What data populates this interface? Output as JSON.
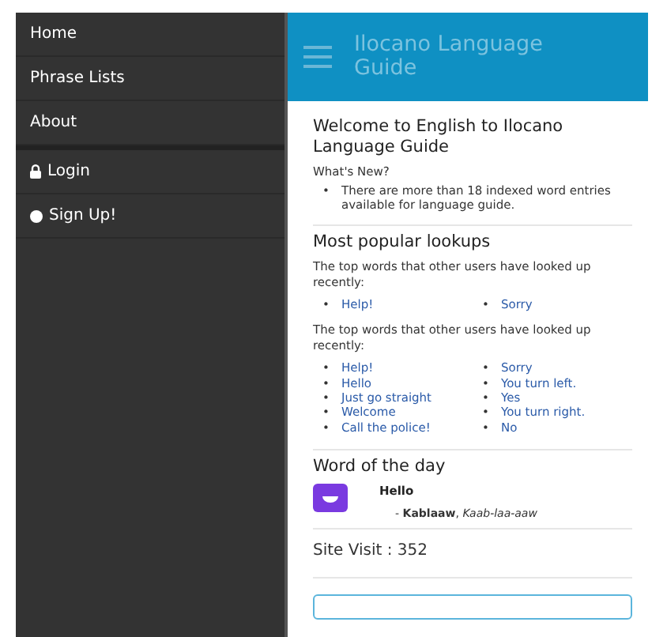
{
  "drawer": {
    "items": [
      {
        "label": "Home"
      },
      {
        "label": "Phrase Lists"
      },
      {
        "label": "About"
      }
    ],
    "account_items": [
      {
        "label": "Login",
        "kind": "lock"
      },
      {
        "label": "Sign Up!",
        "kind": "circle"
      }
    ]
  },
  "bullet": "•",
  "header": {
    "title": "Ilocano Language Guide"
  },
  "welcome": {
    "title": "Welcome to English to Ilocano Language Guide",
    "subtitle": "What's New?",
    "items": [
      "There are more than 18 indexed word entries available for language guide."
    ]
  },
  "popular": {
    "title": "Most popular lookups",
    "groups": [
      {
        "intro": "The top words that other users have looked up recently:",
        "words": [
          "Help!",
          "Sorry"
        ]
      },
      {
        "intro": "The top words that other users have looked up recently:",
        "words": [
          "Help!",
          "Hello",
          "Just go straight",
          "Welcome",
          "Call the police!",
          "Sorry",
          "You turn left.",
          "Yes",
          "You turn right.",
          "No"
        ]
      }
    ]
  },
  "word_of_day": {
    "title": "Word of the day",
    "word": "Hello",
    "translation": "- **Kablaaw**, *Kaab-laa-aaw*"
  },
  "site_visit": "Site Visit : 352"
}
